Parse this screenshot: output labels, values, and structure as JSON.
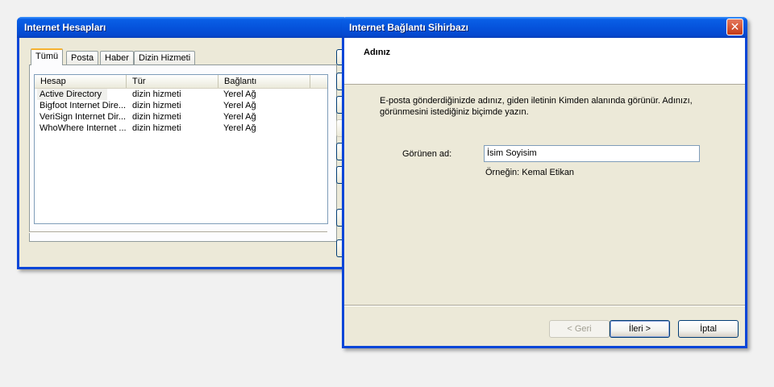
{
  "accounts_window": {
    "title": "Internet Hesapları",
    "tabs": [
      "Tümü",
      "Posta",
      "Haber",
      "Dizin Hizmeti"
    ],
    "columns": [
      "Hesap",
      "Tür",
      "Bağlantı"
    ],
    "rows": [
      {
        "account": "Active Directory",
        "type": "dizin hizmeti",
        "connection": "Yerel Ağ"
      },
      {
        "account": "Bigfoot Internet Dire...",
        "type": "dizin hizmeti",
        "connection": "Yerel Ağ"
      },
      {
        "account": "VeriSign Internet Dir...",
        "type": "dizin hizmeti",
        "connection": "Yerel Ağ"
      },
      {
        "account": "WhoWhere Internet ...",
        "type": "dizin hizmeti",
        "connection": "Yerel Ağ"
      }
    ]
  },
  "wizard": {
    "title": "Internet Bağlantı Sihirbazı",
    "close_label": "✕",
    "header": "Adınız",
    "description": "E-posta gönderdiğinizde adınız, giden iletinin Kimden alanında görünür. Adınızı, görünmesini istediğiniz biçimde yazın.",
    "field_label": "Görünen ad:",
    "field_value": "İsim Soyisim",
    "example": "Örneğin: Kemal Etikan",
    "buttons": {
      "back": "< Geri",
      "next": "İleri >",
      "cancel": "İptal"
    }
  }
}
